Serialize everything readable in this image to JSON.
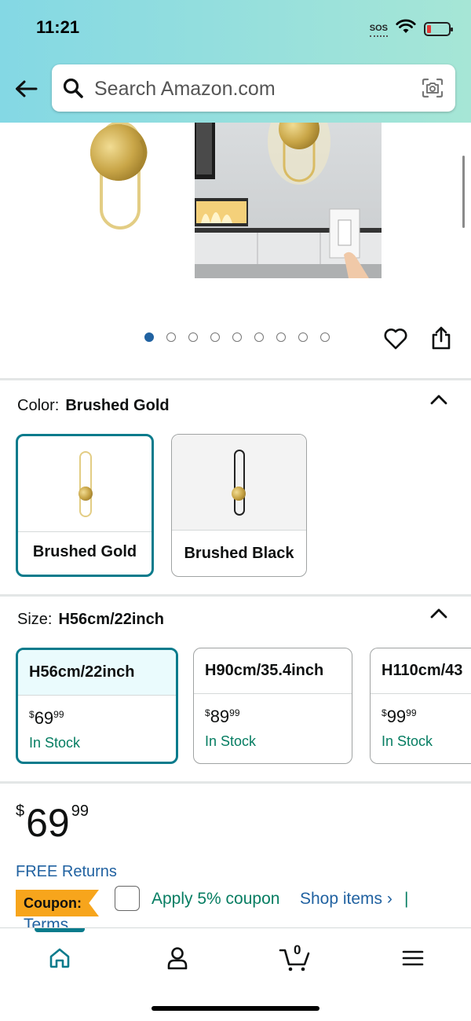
{
  "status_bar": {
    "time": "11:21",
    "sos": "SOS"
  },
  "search": {
    "placeholder": "Search Amazon.com"
  },
  "gallery": {
    "image_count": 9,
    "active_index": 0
  },
  "color": {
    "label": "Color:",
    "selected": "Brushed Gold",
    "options": [
      {
        "label": "Brushed Gold",
        "selected": true
      },
      {
        "label": "Brushed Black",
        "selected": false
      }
    ]
  },
  "size": {
    "label": "Size:",
    "selected": "H56cm/22inch",
    "options": [
      {
        "name": "H56cm/22inch",
        "price_currency": "$",
        "price_whole": "69",
        "price_cents": "99",
        "stock": "In Stock",
        "selected": true
      },
      {
        "name": "H90cm/35.4inch",
        "price_currency": "$",
        "price_whole": "89",
        "price_cents": "99",
        "stock": "In Stock",
        "selected": false
      },
      {
        "name": "H110cm/43",
        "price_currency": "$",
        "price_whole": "99",
        "price_cents": "99",
        "stock": "In Stock",
        "selected": false
      }
    ]
  },
  "price": {
    "currency": "$",
    "whole": "69",
    "cents": "99"
  },
  "free_returns": "FREE Returns",
  "coupon": {
    "tag": "Coupon:",
    "apply_text": "Apply 5% coupon",
    "shop_items": "Shop items ›",
    "separator": "|",
    "terms": "Terms"
  },
  "bottom_nav": {
    "items": [
      "home-icon",
      "account-icon",
      "cart-icon",
      "menu-icon"
    ],
    "cart_count": "0",
    "active": "home"
  },
  "colors": {
    "header_gradient_start": "#84d8e4",
    "header_gradient_end": "#a6e6d6",
    "selected_border": "#0a7b8c",
    "link_blue": "#2162a1",
    "stock_green": "#067d62",
    "coupon_orange": "#f7a51c"
  }
}
